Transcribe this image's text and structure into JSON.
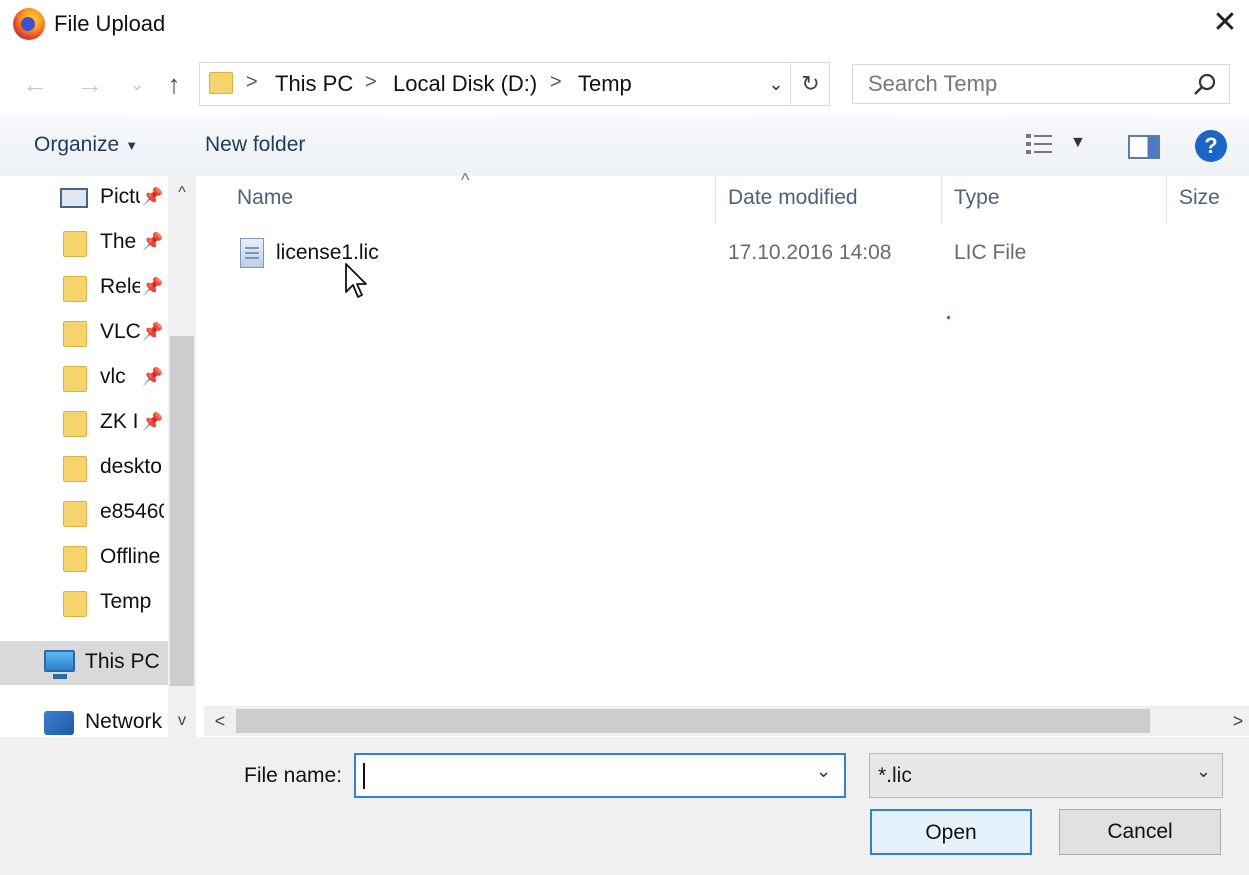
{
  "window": {
    "title": "File Upload",
    "close_label": "✕"
  },
  "navigation": {
    "back_label": "←",
    "forward_label": "→",
    "recent_label": "⌄",
    "up_label": "↑",
    "breadcrumb": [
      "This PC",
      "Local Disk (D:)",
      "Temp"
    ],
    "separator": ">",
    "refresh_label": "↻",
    "dropdown_label": "⌄"
  },
  "search": {
    "placeholder": "Search Temp",
    "value": ""
  },
  "commandbar": {
    "organize_label": "Organize",
    "new_folder_label": "New folder",
    "help_label": "?"
  },
  "sidebar": {
    "scroll_up": "^",
    "scroll_down": "v",
    "items": [
      {
        "label": "Pictures",
        "icon": "pictures-icon",
        "pinned": true
      },
      {
        "label": "The",
        "icon": "folder-icon",
        "pinned": true
      },
      {
        "label": "Rele",
        "icon": "folder-icon",
        "pinned": true
      },
      {
        "label": "VLC",
        "icon": "folder-icon",
        "pinned": true
      },
      {
        "label": "vlc",
        "icon": "folder-icon",
        "pinned": true
      },
      {
        "label": "ZK I",
        "icon": "folder-icon",
        "pinned": true
      },
      {
        "label": "deskto",
        "icon": "folder-icon",
        "pinned": false
      },
      {
        "label": "e85460",
        "icon": "folder-icon",
        "pinned": false
      },
      {
        "label": "Offline",
        "icon": "folder-icon",
        "pinned": false
      },
      {
        "label": "Temp",
        "icon": "folder-icon",
        "pinned": false
      }
    ],
    "this_pc": "This PC",
    "network": "Network",
    "pin_glyph": "📌"
  },
  "columns": {
    "name": "Name",
    "date": "Date modified",
    "type": "Type",
    "size": "Size",
    "sort_glyph": "^"
  },
  "files": [
    {
      "name": "license1.lic",
      "date": "17.10.2016 14:08",
      "type": "LIC File"
    }
  ],
  "hscroll": {
    "left": "<",
    "right": ">"
  },
  "footer": {
    "file_name_label": "File name:",
    "file_name_value": "",
    "filter_value": "*.lic",
    "open_label": "Open",
    "cancel_label": "Cancel"
  },
  "colors": {
    "accent": "#2f7fd8",
    "help": "#1b64c8",
    "folder": "#f6d36b"
  }
}
